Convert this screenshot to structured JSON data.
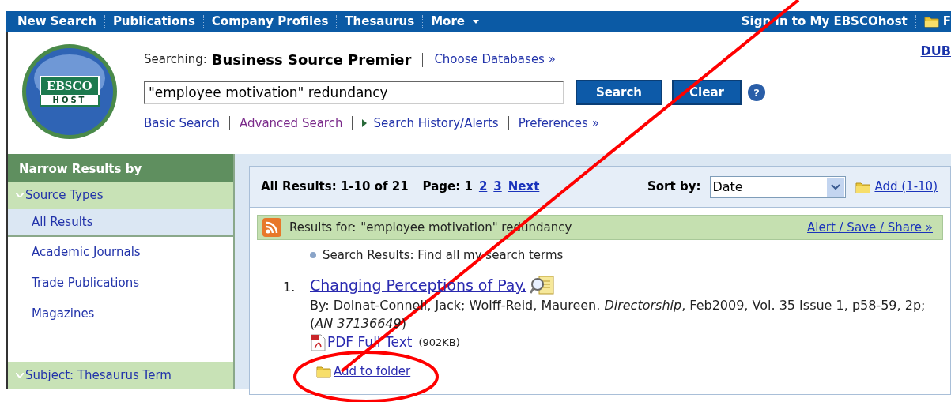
{
  "top_nav": {
    "items": [
      {
        "label": "New Search",
        "dropdown": false
      },
      {
        "label": "Publications",
        "dropdown": false
      },
      {
        "label": "Company Profiles",
        "dropdown": false
      },
      {
        "label": "Thesaurus",
        "dropdown": false
      },
      {
        "label": "More",
        "dropdown": true
      }
    ],
    "sign_in": "Sign In to My EBSCOhost",
    "folder": "F"
  },
  "header": {
    "logo_top": "EBSCO",
    "logo_bottom": "HOST",
    "searching_label": "Searching:",
    "database": "Business Source Premier",
    "choose_databases": "Choose Databases »",
    "query": "\"employee motivation\" redundancy",
    "search_button": "Search",
    "clear_button": "Clear",
    "help": "?",
    "corner_link": "DUB",
    "links": [
      {
        "label": "Basic Search",
        "visited": false,
        "arrow": false
      },
      {
        "label": "Advanced Search",
        "visited": true,
        "arrow": false
      },
      {
        "label": "Search History/Alerts",
        "visited": false,
        "arrow": true
      },
      {
        "label": "Preferences »",
        "visited": false,
        "arrow": false
      }
    ]
  },
  "sidebar": {
    "title": "Narrow Results by",
    "sections": [
      {
        "title": "Source Types",
        "expanded": true,
        "items": [
          {
            "label": "All Results",
            "selected": true
          },
          {
            "label": "Academic Journals",
            "selected": false
          },
          {
            "label": "Trade Publications",
            "selected": false
          },
          {
            "label": "Magazines",
            "selected": false
          }
        ]
      },
      {
        "title": "Subject: Thesaurus Term",
        "expanded": true
      }
    ]
  },
  "results": {
    "summary": "All Results: 1-10 of 21",
    "page_label": "Page: 1",
    "pages": [
      "2",
      "3",
      "Next"
    ],
    "sort_label": "Sort by:",
    "sort_value": "Date",
    "add_link": "Add (1-10)",
    "results_for_label": "Results for:",
    "results_for_query": "\"employee motivation\" redundancy",
    "alert_link": "Alert / Save / Share »",
    "search_mode": "Search Results: Find all my search terms",
    "items": [
      {
        "number": "1.",
        "title": "Changing Perceptions of Pay.",
        "citation": "By: Dolnat-Connell, Jack; Wolff-Reid, Maureen. *Directorship*, Feb2009, Vol. 35 Issue 1, p58-59, 2p; (*AN 37136649*)",
        "full_text": "PDF Full Text",
        "size": "(902KB)",
        "add_to_folder": "Add to folder"
      }
    ]
  }
}
